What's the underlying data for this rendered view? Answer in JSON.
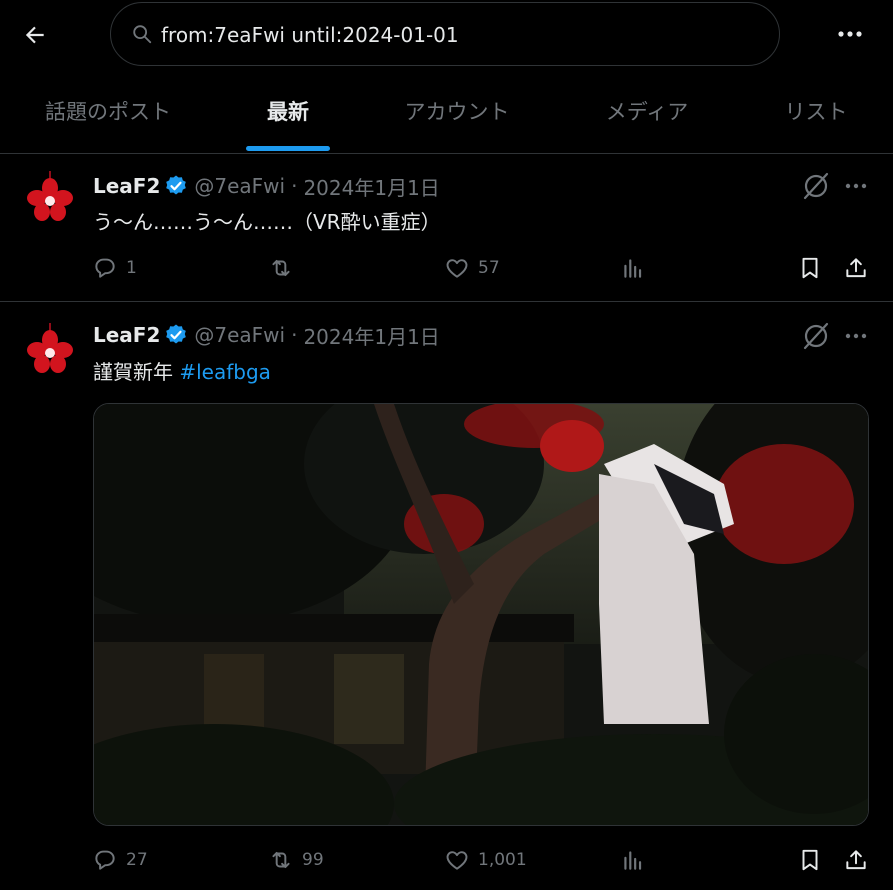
{
  "search": {
    "query": "from:7eaFwi until:2024-01-01"
  },
  "tabs": [
    {
      "label": "話題のポスト",
      "active": false
    },
    {
      "label": "最新",
      "active": true
    },
    {
      "label": "アカウント",
      "active": false
    },
    {
      "label": "メディア",
      "active": false
    },
    {
      "label": "リスト",
      "active": false
    }
  ],
  "posts": [
    {
      "author": "LeaF2",
      "handle": "@7eaFwi",
      "separator": "·",
      "date": "2024年1月1日",
      "text": "う～ん……う～ん……（VR酔い重症）",
      "replies": "1",
      "reposts": "",
      "likes": "57"
    },
    {
      "author": "LeaF2",
      "handle": "@7eaFwi",
      "separator": "·",
      "date": "2024年1月1日",
      "text": "謹賀新年 ",
      "hashtag": "#leafbga",
      "replies": "27",
      "reposts": "99",
      "likes": "1,001"
    }
  ],
  "colors": {
    "accent": "#1d9bf0",
    "muted": "#71767b",
    "text": "#e7e9ea",
    "border": "#2f3336"
  },
  "icons": [
    "back-arrow-icon",
    "search-icon",
    "more-icon",
    "verified-badge-icon",
    "grok-icon",
    "reply-icon",
    "repost-icon",
    "like-icon",
    "views-icon",
    "bookmark-icon",
    "share-icon"
  ]
}
